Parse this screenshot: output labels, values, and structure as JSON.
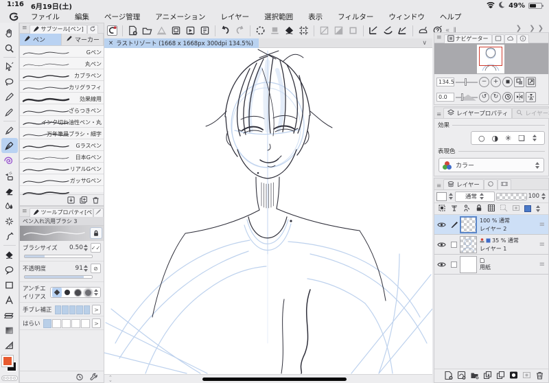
{
  "status_bar": {
    "time": "1:16",
    "date": "6月19日(土)",
    "battery": "49%"
  },
  "menu_bar": {
    "items": [
      "ファイル",
      "編集",
      "ページ管理",
      "アニメーション",
      "レイヤー",
      "選択範囲",
      "表示",
      "フィルター",
      "ウィンドウ",
      "ヘルプ"
    ]
  },
  "canvas": {
    "close_label": "×",
    "tab_title": "ラストリゾート (1668 x 1668px 300dpi 134.5%)"
  },
  "subtool": {
    "title": "サブツール[ペン]",
    "tabs": [
      "ペン",
      "マーカー"
    ],
    "brushes": [
      "Gペン",
      "丸ペン",
      "カブラペン",
      "カリグラフィ",
      "効果線用",
      "ざらつきペン",
      "インク切れ油性ペン・丸",
      "万年筆風ブラシ・細字",
      "Gラスペン",
      "日本Gペン",
      "リアルGペン",
      "ガッサGペン"
    ]
  },
  "tool_property": {
    "title": "ツールプロパティ[ペン",
    "brush_name": "ペン入れ汎用ブラシ 3",
    "brush_size_label": "ブラシサイズ",
    "brush_size_value": "0.50",
    "opacity_label": "不透明度",
    "opacity_value": "91",
    "antialias_label": "アンチエイリアス",
    "stabilize_label": "手ブレ補正",
    "taper_label": "はらい"
  },
  "navigator": {
    "title": "ナビゲーター",
    "zoom_value": "134.5",
    "rotate_value": "0.0"
  },
  "layer_property": {
    "title": "レイヤープロパティ",
    "search_tab": "レイヤー検索",
    "effect_label": "効果",
    "expression_label": "表現色",
    "color_value": "カラー"
  },
  "layers": {
    "title": "レイヤー",
    "blend_mode": "通常",
    "opacity_value": "100",
    "rows": [
      {
        "info": "100 % 通常",
        "name": "レイヤー 2"
      },
      {
        "info": "35 % 通常",
        "name": "レイヤー 1"
      },
      {
        "info": "",
        "name": "用紙"
      }
    ]
  }
}
